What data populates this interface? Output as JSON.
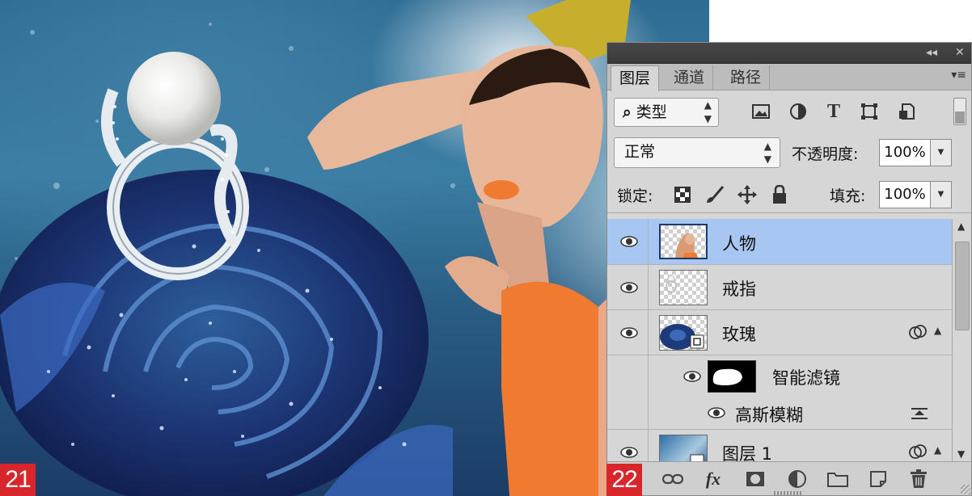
{
  "figures": {
    "left_badge": "21",
    "right_badge": "22"
  },
  "panel": {
    "collapse_glyph": "◂◂",
    "close_glyph": "✕",
    "tabs": [
      {
        "label": "图层",
        "active": true
      },
      {
        "label": "通道",
        "active": false
      },
      {
        "label": "路径",
        "active": false
      }
    ],
    "tab_menu_glyph": "▾≡",
    "filter": {
      "search_glyph": "⌕",
      "kind_label": "类型",
      "icons": [
        "image-filter-icon",
        "adjustment-filter-icon",
        "type-filter-icon",
        "shape-filter-icon",
        "smart-object-filter-icon"
      ]
    },
    "blend": {
      "mode": "正常",
      "opacity_label": "不透明度:",
      "opacity_value": "100%"
    },
    "lock": {
      "label": "锁定:",
      "icons": [
        "lock-transparent-icon",
        "lock-brush-icon",
        "lock-move-icon",
        "lock-all-icon"
      ],
      "fill_label": "填充:",
      "fill_value": "100%"
    },
    "layers": [
      {
        "name": "人物",
        "visible": true,
        "selected": true,
        "kind": "pixel"
      },
      {
        "name": "戒指",
        "visible": true,
        "selected": false,
        "kind": "pixel"
      },
      {
        "name": "玫瑰",
        "visible": true,
        "selected": false,
        "kind": "smart-object"
      },
      {
        "name": "智能滤镜",
        "visible": true,
        "selected": false,
        "kind": "smart-filter"
      },
      {
        "name": "高斯模糊",
        "visible": true,
        "selected": false,
        "kind": "filter-effect"
      },
      {
        "name": "图层 1",
        "visible": true,
        "selected": false,
        "kind": "smart-object"
      }
    ],
    "bottom_icons": [
      "link-layers-icon",
      "fx-icon",
      "add-mask-icon",
      "adjustment-layer-icon",
      "new-group-icon",
      "new-layer-icon",
      "trash-icon"
    ],
    "fx_label": "fx"
  },
  "colors": {
    "badge_red": "#d8262a",
    "selection_blue": "#a8c6f2",
    "panel_gray": "#d6d6d6"
  }
}
